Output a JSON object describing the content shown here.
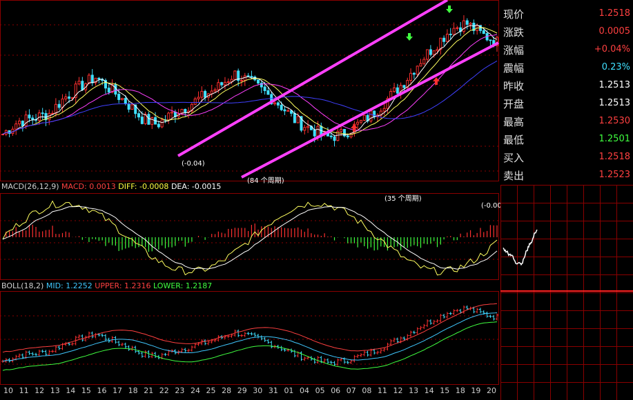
{
  "panels": {
    "macd": {
      "name": "MACD(26,12,9)",
      "items": [
        {
          "label": "MACD:",
          "value": "0.0013",
          "color": "#ff4040"
        },
        {
          "label": "DIFF:",
          "value": "-0.0008",
          "color": "#ffff40"
        },
        {
          "label": "DEA:",
          "value": "-0.0015",
          "color": "#ffffff"
        }
      ]
    },
    "boll": {
      "name": "BOLL(18,2)",
      "items": [
        {
          "label": "MID:",
          "value": "1.2252",
          "color": "#40c8ff"
        },
        {
          "label": "UPPER:",
          "value": "1.2316",
          "color": "#ff4040"
        },
        {
          "label": "LOWER:",
          "value": "1.2187",
          "color": "#40ff40"
        }
      ]
    }
  },
  "annotations": {
    "main_value": "(-0.04)",
    "main_period": "(84 个周期)",
    "macd_period": "(35 个周期)",
    "macd_right": "(-0.00"
  },
  "x_axis": {
    "labels": [
      "10",
      "11",
      "12",
      "13",
      "14",
      "15",
      "16",
      "17",
      "18",
      "21",
      "22",
      "23",
      "24",
      "25",
      "28",
      "29",
      "30",
      "31",
      "01",
      "04",
      "05",
      "06",
      "07",
      "08",
      "11",
      "12",
      "13",
      "14",
      "15",
      "18",
      "19",
      "20"
    ]
  },
  "quote": {
    "rows": [
      {
        "label": "现价",
        "value": "1.2518",
        "color": "#ff4040"
      },
      {
        "label": "涨跌",
        "value": "0.0005",
        "color": "#ff4040"
      },
      {
        "label": "涨幅",
        "value": "+0.04%",
        "color": "#ff4040"
      },
      {
        "label": "震幅",
        "value": "0.23%",
        "color": "#40e0ff"
      },
      {
        "label": "昨收",
        "value": "1.2513",
        "color": "#ffffff"
      },
      {
        "label": "开盘",
        "value": "1.2513",
        "color": "#ffffff"
      },
      {
        "label": "最高",
        "value": "1.2530",
        "color": "#ff4040"
      },
      {
        "label": "最低",
        "value": "1.2501",
        "color": "#40ff40"
      },
      {
        "label": "买入",
        "value": "1.2518",
        "color": "#ff4040"
      },
      {
        "label": "卖出",
        "value": "1.2523",
        "color": "#ff4040"
      }
    ]
  },
  "colors": {
    "up": "#ff3030",
    "down": "#40e0ff",
    "grid": "#8b0000",
    "channel": "#ff40ff",
    "ma5": "#ffffff",
    "ma10": "#ffff60",
    "ma20": "#ff40ff",
    "ma60": "#4040ff"
  },
  "chart_data": {
    "type": "candlestick",
    "title": "",
    "x_labels": [
      "10",
      "11",
      "12",
      "13",
      "14",
      "15",
      "16",
      "17",
      "18",
      "21",
      "22",
      "23",
      "24",
      "25",
      "28",
      "29",
      "30",
      "31",
      "01",
      "04",
      "05",
      "06",
      "07",
      "08",
      "11",
      "12",
      "13",
      "14",
      "15",
      "18",
      "19",
      "20"
    ],
    "price_trend_control_points": [
      0.22,
      0.3,
      0.32,
      0.35,
      0.45,
      0.52,
      0.58,
      0.5,
      0.42,
      0.32,
      0.28,
      0.35,
      0.4,
      0.46,
      0.52,
      0.6,
      0.55,
      0.48,
      0.4,
      0.3,
      0.25,
      0.2,
      0.22,
      0.28,
      0.35,
      0.45,
      0.55,
      0.68,
      0.78,
      0.88,
      0.92,
      0.85,
      0.8
    ],
    "macd_histogram_signs": "mixed",
    "boll": {
      "mid": 1.2252,
      "upper": 1.2316,
      "lower": 1.2187
    },
    "macd": {
      "macd": 0.0013,
      "diff": -0.0008,
      "dea": -0.0015
    }
  }
}
